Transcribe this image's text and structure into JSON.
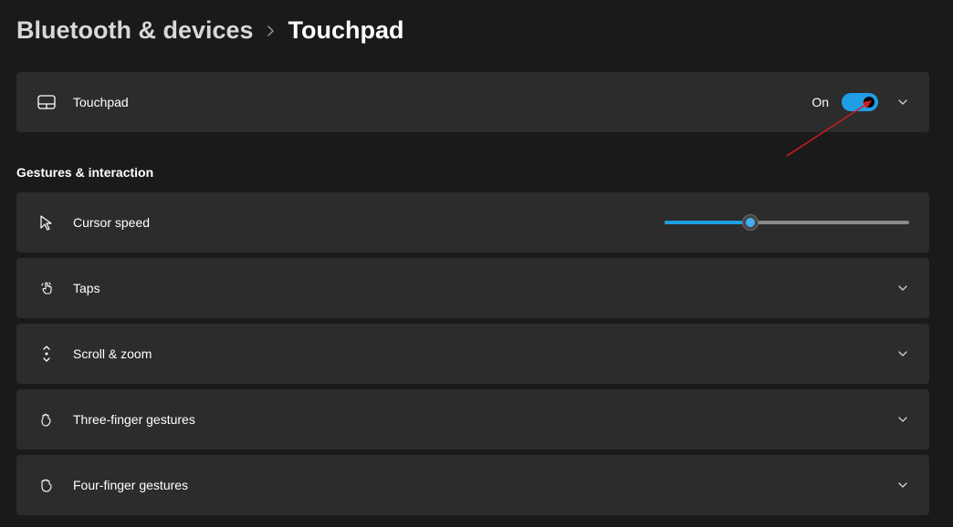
{
  "breadcrumb": {
    "parent": "Bluetooth & devices",
    "current": "Touchpad"
  },
  "touchpad_card": {
    "label": "Touchpad",
    "status_text": "On",
    "toggle_on": true
  },
  "section_title": "Gestures & interaction",
  "cursor_speed": {
    "label": "Cursor speed",
    "value_percent": 35
  },
  "rows": {
    "taps": "Taps",
    "scroll_zoom": "Scroll & zoom",
    "three_finger": "Three-finger gestures",
    "four_finger": "Four-finger gestures"
  },
  "colors": {
    "accent": "#1f9ee6",
    "annotation": "#d31c1c"
  }
}
